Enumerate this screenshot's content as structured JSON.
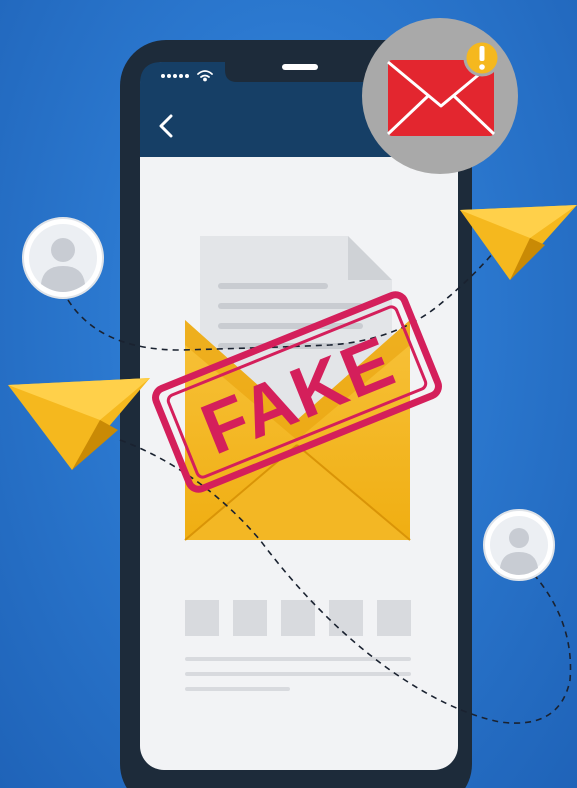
{
  "stamp": {
    "text": "FAKE"
  },
  "icons": {
    "status_signal": "signal-dots-icon",
    "wifi": "wifi-icon",
    "back": "chevron-left-icon",
    "mail_alert": "envelope-alert-icon",
    "paper_plane": "paper-plane-icon",
    "user_avatar": "user-avatar-icon"
  },
  "colors": {
    "background": "#2b78cf",
    "phone_frame": "#1d2b3a",
    "header": "#163f66",
    "envelope": "#f5b81e",
    "stamp": "#d41f5b",
    "mail_icon": "#e3262f",
    "alert_badge": "#f5b81e"
  }
}
